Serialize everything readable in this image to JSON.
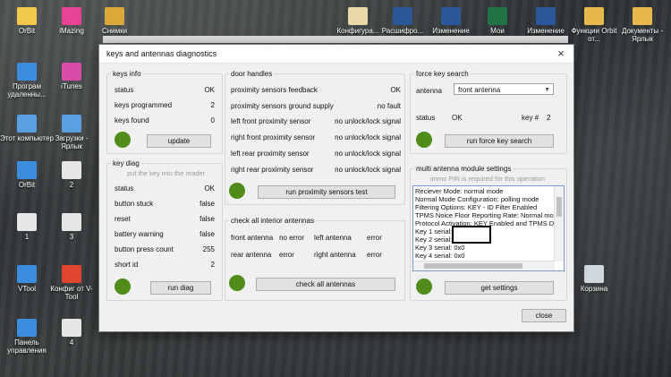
{
  "desktop": {
    "icons": [
      {
        "label": "OrBit",
        "color": "#f2c94c"
      },
      {
        "label": "iMazing",
        "color": "#e84393"
      },
      {
        "label": "Снимки",
        "color": "#dba93a"
      },
      {
        "label": "Конфигура...",
        "color": "#e9d7a8"
      },
      {
        "label": "Расшифро...",
        "color": "#2b579a"
      },
      {
        "label": "Изменение",
        "color": "#2b579a"
      },
      {
        "label": "Мои",
        "color": "#217346"
      },
      {
        "label": "Изменение",
        "color": "#2b579a"
      },
      {
        "label": "Функции Orbit от...",
        "color": "#e8b84a"
      },
      {
        "label": "Документы - Ярлык",
        "color": "#e8b84a"
      },
      {
        "label": "Програм удаленны...",
        "color": "#3c8dde"
      },
      {
        "label": "iTunes",
        "color": "#d94da8"
      },
      {
        "label": "Этот компьютер",
        "color": "#5aa0e0"
      },
      {
        "label": "Загрузки - Ярлык",
        "color": "#5aa0e0"
      },
      {
        "label": "OrBit",
        "color": "#3c8dde"
      },
      {
        "label": "2",
        "color": "#e6e6e6"
      },
      {
        "label": "1",
        "color": "#e6e6e6"
      },
      {
        "label": "3",
        "color": "#e6e6e6"
      },
      {
        "label": "VTool",
        "color": "#3c8dde"
      },
      {
        "label": "Конфиг от V-Tool",
        "color": "#e0462f"
      },
      {
        "label": "Корзина",
        "color": "#cfd8dc"
      },
      {
        "label": "Панель управления",
        "color": "#3c8dde"
      },
      {
        "label": "4",
        "color": "#e6e6e6"
      }
    ]
  },
  "window": {
    "title": "keys and antennas diagnostics",
    "close_symbol": "×",
    "close_button": "close"
  },
  "keys_info": {
    "title": "keys info",
    "rows": [
      {
        "label": "status",
        "value": "OK"
      },
      {
        "label": "keys programmed",
        "value": "2"
      },
      {
        "label": "keys found",
        "value": "0"
      }
    ],
    "button": "update"
  },
  "key_diag": {
    "title": "key diag",
    "hint": "put the key into the reader",
    "rows": [
      {
        "label": "status",
        "value": "OK"
      },
      {
        "label": "button stuck",
        "value": "false"
      },
      {
        "label": "reset",
        "value": "false"
      },
      {
        "label": "battery warning",
        "value": "false"
      },
      {
        "label": "button press count",
        "value": "255"
      },
      {
        "label": "short id",
        "value": "2"
      }
    ],
    "button": "run diag"
  },
  "door_handles": {
    "title": "door handles",
    "rows": [
      {
        "label": "proximity sensors feedback",
        "value": "OK"
      },
      {
        "label": "proximity sensors ground supply",
        "value": "no fault"
      },
      {
        "label": "left front proximity sensor",
        "value": "no unlock/lock signal"
      },
      {
        "label": "right front proximity sensor",
        "value": "no unlock/lock signal"
      },
      {
        "label": "left rear proximity sensor",
        "value": "no unlock/lock signal"
      },
      {
        "label": "right rear proximity sensor",
        "value": "no unlock/lock signal"
      }
    ],
    "button": "run proximity sensors test"
  },
  "interior_antennas": {
    "title": "check all interior antennas",
    "rows": [
      {
        "a": "front antenna",
        "av": "no error",
        "b": "left antenna",
        "bv": "error"
      },
      {
        "a": "rear antenna",
        "av": "error",
        "b": "right antenna",
        "bv": "error"
      }
    ],
    "button": "check all antennas"
  },
  "force_key": {
    "title": "force key search",
    "antenna_label": "antenna",
    "antenna_value": "front antenna",
    "status_label": "status",
    "status_value": "OK",
    "key_label": "key #",
    "key_value": "2",
    "button": "run force key search"
  },
  "multi_antenna": {
    "title": "multi antenna module settings",
    "hint": "immo PIN is required for this operation",
    "lines": [
      "Reciever Mode: normal mode",
      "Normal Mode Configuration: polling mode",
      "Filtering Options: KEY - ID Filter Enabled",
      "TPMS Noice Floor Reporting Rate: Normal mo",
      "Protocol Activation: KEY Enabled and TPMS D",
      "Key 1 serial:",
      "Key 2 serial:",
      "Key 3 serial: 0x0",
      "Key 4 serial: 0x0"
    ],
    "button": "get settings"
  },
  "colors": {
    "led": "#4f8c1a",
    "accent": "#7a9cd3"
  }
}
